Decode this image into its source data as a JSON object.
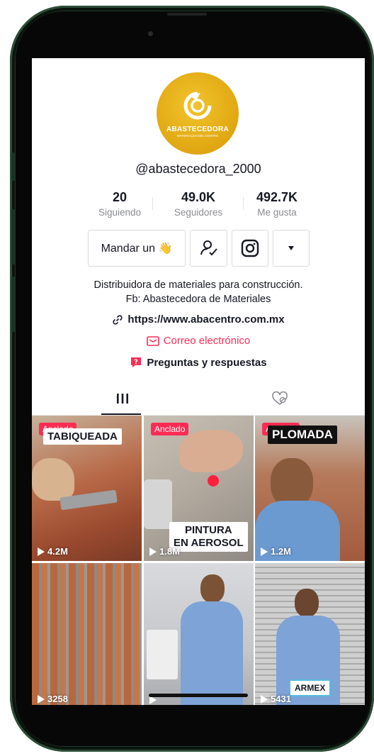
{
  "profile": {
    "logo_title": "ABASTECEDORA",
    "logo_subtitle": "MATERIALES DEL CENTRO",
    "handle": "@abastecedora_2000",
    "stats": [
      {
        "value": "20",
        "label": "Siguiendo"
      },
      {
        "value": "49.0K",
        "label": "Seguidores"
      },
      {
        "value": "492.7K",
        "label": "Me gusta"
      }
    ],
    "message_button": "Mandar un 👋",
    "bio_line1": "Distribuidora de materiales para construcción.",
    "bio_line2": "Fb: Abastecedora de Materiales",
    "link": "https://www.abacentro.com.mx",
    "email_label": "Correo electrónico",
    "qa_label": "Preguntas y respuestas"
  },
  "icons": {
    "follow": "user-check-icon",
    "instagram": "instagram-icon",
    "more": "caret-down-icon",
    "link": "link-icon",
    "mail": "mail-icon",
    "qa": "question-icon",
    "videos_tab": "grid-icon",
    "liked_tab": "hidden-heart-icon"
  },
  "colors": {
    "accent": "#fe2c55",
    "logo": "#e8b417",
    "frame": "#1f3a2a",
    "text": "#161823",
    "muted": "#8a8b91"
  },
  "videos": [
    {
      "pinned": "Anclado",
      "caption": "TABIQUEADA",
      "views": "4.2M"
    },
    {
      "pinned": "Anclado",
      "caption": "PINTURA\nEN AEROSOL",
      "views": "1.8M"
    },
    {
      "pinned": "Anclado",
      "caption": "PLOMADA",
      "views": "1.2M"
    },
    {
      "pinned": "",
      "caption": "",
      "views": "3258"
    },
    {
      "pinned": "",
      "caption": "",
      "views": ""
    },
    {
      "pinned": "",
      "caption": "ARMEX",
      "views": "5431"
    }
  ]
}
